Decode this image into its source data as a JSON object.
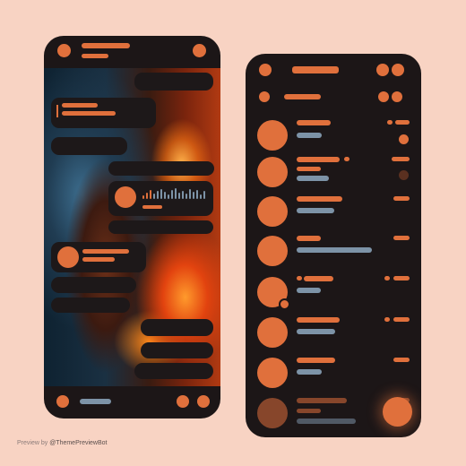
{
  "colors": {
    "accent": "#e0703c",
    "surface": "#1c1617",
    "secondary_text": "#7d93a7",
    "background": "#f8d3c3"
  },
  "footer": {
    "prefix": "Preview by",
    "handle": "@ThemePreviewBot"
  },
  "chat_screen": {
    "voice_waveform": [
      4,
      7,
      10,
      6,
      9,
      11,
      8,
      5,
      10,
      12,
      7,
      9,
      6,
      11,
      8,
      10,
      5,
      9
    ]
  },
  "chat_list": {
    "rows": 8
  }
}
